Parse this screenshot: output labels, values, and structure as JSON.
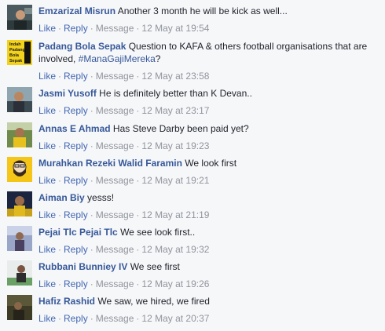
{
  "actions": {
    "like": "Like",
    "reply": "Reply",
    "message": "Message",
    "separator": "·"
  },
  "comments": [
    {
      "author": "Emzarizal Misrun",
      "text": "Another 3 month he will be kick as well...",
      "time": "12 May at 19:54"
    },
    {
      "author": "Padang Bola Sepak",
      "text": "Question to KAFA & others football organisations that are involved, ",
      "hashtag": "#ManaGajiMereka",
      "text_after": "?",
      "time": "12 May at 23:58",
      "avatar_text": [
        "Indah",
        "Padang",
        "Bola",
        "Sepak"
      ]
    },
    {
      "author": "Jasmi Yusoff",
      "text": "He is definitely better than K Devan..",
      "time": "12 May at 23:17"
    },
    {
      "author": "Annas E Ahmad",
      "text": "Has Steve Darby been paid yet?",
      "time": "12 May at 19:23"
    },
    {
      "author": "Murahkan Rezeki Walid Faramin",
      "text": "We look first",
      "time": "12 May at 19:21"
    },
    {
      "author": "Aiman Biy",
      "text": "yesss!",
      "time": "12 May at 21:19"
    },
    {
      "author": "Pejai Tlc Pejai Tlc",
      "text": "We see look first..",
      "time": "12 May at 19:32"
    },
    {
      "author": "Rubbani Bunniey IV",
      "text": "We see first",
      "time": "12 May at 19:26"
    },
    {
      "author": "Hafiz Rashid",
      "text": "We saw, we hired, we fired",
      "time": "12 May at 20:37"
    }
  ]
}
